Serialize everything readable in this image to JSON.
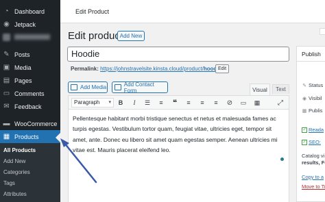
{
  "sidebar": {
    "items": [
      {
        "label": "Dashboard",
        "icon": "dashboard-icon"
      },
      {
        "label": "Jetpack",
        "icon": "jetpack-icon"
      },
      {
        "label": "Posts",
        "icon": "pin-icon"
      },
      {
        "label": "Media",
        "icon": "media-icon"
      },
      {
        "label": "Pages",
        "icon": "pages-icon"
      },
      {
        "label": "Comments",
        "icon": "comments-icon"
      },
      {
        "label": "Feedback",
        "icon": "feedback-icon"
      },
      {
        "label": "WooCommerce",
        "icon": "woocommerce-icon"
      },
      {
        "label": "Products",
        "icon": "products-icon"
      }
    ],
    "submenu": [
      "All Products",
      "Add New",
      "Categories",
      "Tags",
      "Attributes"
    ]
  },
  "topbar": {
    "title": "Edit Product"
  },
  "header": {
    "title": "Edit product",
    "add_new": "Add New"
  },
  "post": {
    "title": "Hoodie",
    "permalink_label": "Permalink:",
    "permalink_base": "https://johnstravelsite.kinsta.cloud/product/",
    "permalink_slug": "hoodie",
    "permalink_end": "/",
    "edit_label": "Edit"
  },
  "editor": {
    "add_media": "Add Media",
    "add_contact_form": "Add Contact Form",
    "tab_visual": "Visual",
    "tab_text": "Text",
    "format": "Paragraph",
    "content": "Pellentesque habitant morbi tristique senectus et netus et malesuada fames ac turpis egestas. Vestibulum tortor quam, feugiat vitae, ultricies eget, tempor sit amet, ante. Donec eu libero sit amet quam egestas semper. Aenean ultricies mi vitae est. Mauris placerat eleifend leo."
  },
  "publish": {
    "title": "Publish",
    "status": "Status",
    "visibility": "Visibil",
    "published": "Publis",
    "readability": "Reada",
    "seo": "SEO:",
    "catalog1": "Catalog vi",
    "catalog2": "results, Fe",
    "copy": "Copy to a",
    "trash": "Move to Tr"
  },
  "colors": {
    "accent": "#2271b1",
    "sidebar_bg": "#1d2327",
    "annotation": "#3a5aa8"
  }
}
